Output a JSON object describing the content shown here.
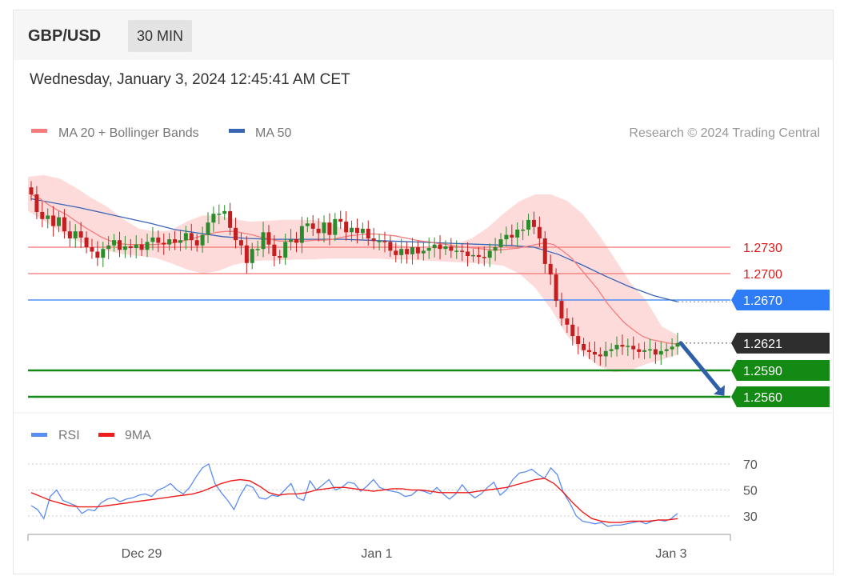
{
  "header": {
    "symbol": "GBP/USD",
    "timeframe": "30 MIN",
    "timestamp": "Wednesday, January 3, 2024 12:45:41 AM CET"
  },
  "copyright": "Research © 2024 Trading Central",
  "colors": {
    "ma20": "#f47c7c",
    "bands_fill": "#fdd5d5",
    "ma50": "#3a64b4",
    "resistance": "#f37373",
    "pivot": "#2e7cf6",
    "support": "#138a13",
    "current": "#2e2e2e",
    "arrow": "#2f5fa8",
    "rsi": "#5a8df0",
    "rsi_ma": "#ee1c1c",
    "bull": "#2c8c2c",
    "bear": "#c41e1e"
  },
  "chart_data": [
    {
      "type": "candlestick",
      "title": "GBP/USD",
      "legend": [
        {
          "name": "MA 20 + Bollinger Bands",
          "color": "#f47c7c"
        },
        {
          "name": "MA 50",
          "color": "#3a64b4"
        }
      ],
      "legend_position": "top-left",
      "x_ticks": [
        "Dec 29",
        "Jan 1",
        "Jan 3"
      ],
      "levels": [
        {
          "label": "1.2730",
          "value": 1.273,
          "kind": "resistance"
        },
        {
          "label": "1.2700",
          "value": 1.27,
          "kind": "resistance"
        },
        {
          "label": "1.2670",
          "value": 1.267,
          "kind": "pivot"
        },
        {
          "label": "1.2621",
          "value": 1.2621,
          "kind": "current"
        },
        {
          "label": "1.2590",
          "value": 1.259,
          "kind": "support"
        },
        {
          "label": "1.2560",
          "value": 1.256,
          "kind": "support"
        }
      ],
      "close_path": [
        1.279,
        1.277,
        1.2762,
        1.2766,
        1.2754,
        1.2764,
        1.2748,
        1.274,
        1.2748,
        1.2741,
        1.273,
        1.2725,
        1.2718,
        1.2728,
        1.2732,
        1.2738,
        1.2727,
        1.2731,
        1.2729,
        1.2733,
        1.2727,
        1.2736,
        1.2741,
        1.2735,
        1.2733,
        1.2739,
        1.2735,
        1.2738,
        1.2746,
        1.2738,
        1.2732,
        1.2744,
        1.2758,
        1.2768,
        1.2768,
        1.2771,
        1.2752,
        1.2738,
        1.2732,
        1.2712,
        1.2728,
        1.2728,
        1.2747,
        1.2733,
        1.272,
        1.2718,
        1.2736,
        1.2739,
        1.2735,
        1.2754,
        1.2757,
        1.2751,
        1.2746,
        1.2758,
        1.2744,
        1.2762,
        1.2759,
        1.2747,
        1.2752,
        1.2746,
        1.2751,
        1.274,
        1.2737,
        1.2737,
        1.2736,
        1.2726,
        1.2721,
        1.2728,
        1.2722,
        1.273,
        1.2723,
        1.2726,
        1.2729,
        1.2733,
        1.2728,
        1.2731,
        1.2726,
        1.2726,
        1.2725,
        1.272,
        1.2721,
        1.2719,
        1.2718,
        1.2726,
        1.273,
        1.2739,
        1.2744,
        1.2741,
        1.275,
        1.275,
        1.2761,
        1.2753,
        1.274,
        1.2711,
        1.2699,
        1.2669,
        1.2649,
        1.2642,
        1.2629,
        1.262,
        1.2613,
        1.2611,
        1.2608,
        1.2606,
        1.2612,
        1.2614,
        1.2619,
        1.2617,
        1.2618,
        1.2614,
        1.2611,
        1.2613,
        1.2614,
        1.2608,
        1.2612,
        1.2614,
        1.2617,
        1.2621
      ],
      "ma20_path": [
        1.279,
        1.2785,
        1.2778,
        1.2772,
        1.2767,
        1.276,
        1.2753,
        1.2747,
        1.2741,
        1.2737,
        1.2734,
        1.2733,
        1.2733,
        1.2733,
        1.2733,
        1.2734,
        1.2735,
        1.2737,
        1.2739,
        1.2742,
        1.2745,
        1.2747,
        1.2748,
        1.2748,
        1.2746,
        1.2744,
        1.2741,
        1.2739,
        1.2737,
        1.2737,
        1.2737,
        1.2737,
        1.2738,
        1.2738,
        1.2739,
        1.2741,
        1.2743,
        1.2744,
        1.2745,
        1.2745,
        1.2744,
        1.2743,
        1.2741,
        1.2739,
        1.2737,
        1.2736,
        1.2734,
        1.2733,
        1.2731,
        1.273,
        1.2729,
        1.2728,
        1.2727,
        1.2727,
        1.2728,
        1.2729,
        1.2731,
        1.2733,
        1.2735,
        1.2733,
        1.2726,
        1.2718,
        1.2706,
        1.2694,
        1.2682,
        1.2667,
        1.2655,
        1.2644,
        1.2636,
        1.2629,
        1.2625,
        1.2623,
        1.2621,
        1.262
      ],
      "ma50_path": [
        1.2785,
        1.278,
        1.2775,
        1.2769,
        1.2763,
        1.2757,
        1.275,
        1.2746,
        1.2742,
        1.274,
        1.2739,
        1.2739,
        1.2739,
        1.2739,
        1.2738,
        1.2737,
        1.2736,
        1.2735,
        1.2734,
        1.2733,
        1.2732,
        1.273,
        1.2722,
        1.271,
        1.2697,
        1.2685,
        1.2675,
        1.2668
      ],
      "band_upper_path": [
        1.281,
        1.2812,
        1.2808,
        1.2798,
        1.2786,
        1.2776,
        1.2762,
        1.2751,
        1.2748,
        1.2749,
        1.2759,
        1.2766,
        1.2766,
        1.2762,
        1.2759,
        1.276,
        1.2761,
        1.2761,
        1.2761,
        1.2758,
        1.275,
        1.2743,
        1.2738,
        1.2734,
        1.2731,
        1.2729,
        1.273,
        1.2734,
        1.274,
        1.2752,
        1.2768,
        1.2782,
        1.279,
        1.279,
        1.2783,
        1.2768,
        1.2745,
        1.2718,
        1.269,
        1.267,
        1.264,
        1.263
      ],
      "band_lower_path": [
        1.2771,
        1.276,
        1.2748,
        1.2738,
        1.2731,
        1.2726,
        1.2722,
        1.272,
        1.2718,
        1.2712,
        1.2705,
        1.27,
        1.2703,
        1.271,
        1.2714,
        1.2715,
        1.2715,
        1.2716,
        1.2716,
        1.2717,
        1.2717,
        1.2717,
        1.2717,
        1.2716,
        1.2716,
        1.2715,
        1.2714,
        1.2713,
        1.2712,
        1.2711,
        1.2709,
        1.27,
        1.2684,
        1.266,
        1.263,
        1.261,
        1.2595,
        1.2588,
        1.259,
        1.2597,
        1.2602,
        1.2608
      ]
    },
    {
      "type": "line",
      "legend": [
        {
          "name": "RSI",
          "color": "#5a8df0"
        },
        {
          "name": "9MA",
          "color": "#ee1c1c"
        }
      ],
      "legend_position": "top-left",
      "y_ticks": [
        "70",
        "50",
        "30"
      ],
      "ylim": [
        20,
        80
      ],
      "rsi": [
        38,
        35,
        28,
        45,
        50,
        42,
        40,
        38,
        32,
        35,
        34,
        40,
        43,
        44,
        41,
        43,
        44,
        46,
        47,
        45,
        50,
        52,
        55,
        50,
        47,
        52,
        60,
        67,
        70,
        55,
        48,
        42,
        35,
        46,
        54,
        52,
        44,
        43,
        46,
        45,
        50,
        55,
        44,
        42,
        57,
        50,
        54,
        58,
        50,
        52,
        56,
        55,
        49,
        53,
        58,
        52,
        50,
        49,
        48,
        45,
        46,
        50,
        49,
        47,
        52,
        47,
        43,
        47,
        54,
        48,
        44,
        47,
        52,
        56,
        46,
        50,
        58,
        63,
        64,
        66,
        62,
        59,
        67,
        62,
        48,
        40,
        30,
        26,
        25,
        24,
        25,
        22,
        23,
        23,
        24,
        25,
        26,
        24,
        26,
        27,
        26,
        28,
        32
      ],
      "rsi_ma": [
        48,
        45,
        42,
        40,
        38,
        37,
        37,
        37,
        38,
        39,
        40,
        41,
        42,
        43,
        44,
        45,
        46,
        47,
        49,
        52,
        55,
        57,
        58,
        57,
        53,
        48,
        46,
        47,
        47,
        48,
        50,
        51,
        52,
        52,
        51,
        50,
        49,
        50,
        51,
        51,
        50,
        50,
        49,
        48,
        48,
        48,
        48,
        49,
        50,
        51,
        52,
        54,
        56,
        58,
        59,
        55,
        48,
        40,
        33,
        28,
        26,
        25,
        25,
        26,
        26,
        26,
        27,
        27,
        28
      ]
    }
  ]
}
